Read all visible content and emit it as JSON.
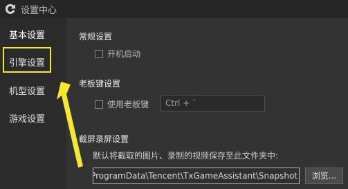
{
  "window": {
    "title": "设置中心"
  },
  "sidebar": {
    "items": [
      {
        "label": "基本设置"
      },
      {
        "label": "引擎设置"
      },
      {
        "label": "机型设置"
      },
      {
        "label": "游戏设置"
      }
    ]
  },
  "main": {
    "general": {
      "title": "常规设置",
      "autostart_label": "开机启动"
    },
    "bosskey": {
      "title": "老板键设置",
      "use_label": "使用老板键",
      "hotkey_value": "Ctrl + `"
    },
    "screenshot": {
      "title": "截屏录屏设置",
      "description": "默认将截取的图片、录制的视频保存至此文件夹中:",
      "path_value": "C:\\Users\\Admin\\Documents\\ProgramData\\Tencent\\TxGameAssistant\\Snapshot",
      "browse_label": "浏览..."
    }
  },
  "colors": {
    "highlight": "#f4ea2b",
    "background": "#2b2b2b",
    "panel": "#333333"
  },
  "icons": {
    "app": "tencent-gaming-buddy-logo",
    "annotation": "yellow-arrow"
  }
}
